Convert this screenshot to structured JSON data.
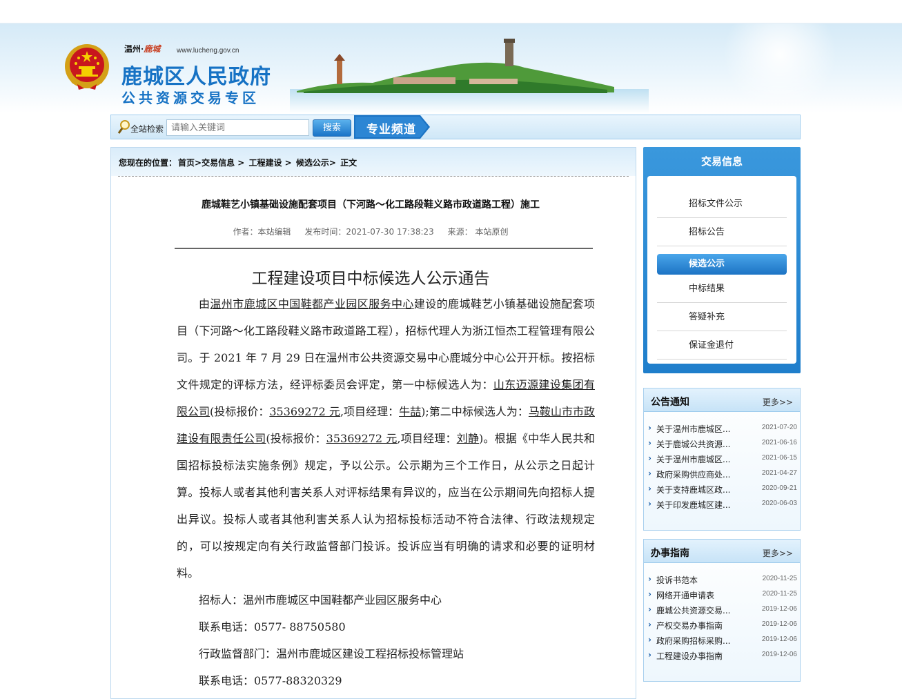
{
  "header": {
    "site_small": "温州·",
    "site_small_brush": "鹿城",
    "site_url": "www.lucheng.gov.cn",
    "site_title": "鹿城区人民政府",
    "site_subtitle": "公共资源交易专区"
  },
  "search": {
    "label": "全站检索",
    "placeholder": "请输入关键词",
    "button_label": "搜索",
    "channel_label": "专业频道"
  },
  "breadcrumb": {
    "prefix": "您现在的位置：",
    "items": [
      "首页>交易信息 >",
      "工程建设 >",
      "候选公示>",
      "正文"
    ]
  },
  "article": {
    "title": "鹿城鞋艺小镇基础设施配套项目（下河路～化工路段鞋义路市政道路工程）施工",
    "author": "作者：本站编辑",
    "publish_time": "发布时间：2021-07-30 17:38:23",
    "source": "来源： 本站原创",
    "notice_title": "工程建设项目中标候选人公示通告",
    "p1_a": "由",
    "p1_link": "温州市鹿城区中国鞋都产业园区服务中心",
    "p1_b": "建设的鹿城鞋艺小镇基础设施配套项目（下河路～化工路段鞋义路市政道路工程），招标代理人为浙江恒杰工程管理有限公司。于 2021 年 7 月 29 日在温州市公共资源交易中心鹿城分中心公开开标。按招标文件规定的评标方法，经评标委员会评定，第一中标候选人为：",
    "cand1": "山东迈源建设集团有限公司",
    "bid_label_1": "(投标报价：",
    "bid1": "35369272 元",
    "pm_label_1": ",项目经理：",
    "pm1": "牛喆",
    "second_label": ");第二中标候选人为：",
    "cand2": "马鞍山市市政建设有限责任公司",
    "bid_label_2": "(投标报价：",
    "bid2": "35369272 元",
    "pm_label_2": ",项目经理：",
    "pm2": "刘静",
    "p1_end": ")。根据《中华人民共和国招标投标法实施条例》规定，予以公示。公示期为三个工作日，从公示之日起计算。投标人或者其他利害关系人对评标结果有异议的，应当在公示期间先向招标人提出异议。投标人或者其他利害关系人认为招标投标活动不符合法律、行政法规规定的，可以按规定向有关行政监督部门投诉。投诉应当有明确的请求和必要的证明材料。",
    "tenderer": "招标人：温州市鹿城区中国鞋都产业园区服务中心",
    "phone1": "联系电话：0577- 88750580",
    "supervisor": "行政监督部门：温州市鹿城区建设工程招标投标管理站",
    "phone2": "联系电话：0577-88320329"
  },
  "sidebar": {
    "title": "交易信息",
    "items": [
      "招标文件公示",
      "招标公告",
      "候选公示",
      "中标结果",
      "答疑补充",
      "保证金退付"
    ],
    "active_index": 2
  },
  "notices": {
    "title": "公告通知",
    "more": "更多>>",
    "rows": [
      {
        "title": "关于温州市鹿城区...",
        "date": "2021-07-20"
      },
      {
        "title": "关于鹿城公共资源...",
        "date": "2021-06-16"
      },
      {
        "title": "关于温州市鹿城区...",
        "date": "2021-06-15"
      },
      {
        "title": "政府采购供应商处...",
        "date": "2021-04-27"
      },
      {
        "title": "关于支持鹿城区政...",
        "date": "2020-09-21"
      },
      {
        "title": "关于印发鹿城区建...",
        "date": "2020-06-03"
      }
    ]
  },
  "guides": {
    "title": "办事指南",
    "more": "更多>>",
    "rows": [
      {
        "title": "投诉书范本",
        "date": "2020-11-25"
      },
      {
        "title": "网络开通申请表",
        "date": "2020-11-25"
      },
      {
        "title": "鹿城公共资源交易...",
        "date": "2019-12-06"
      },
      {
        "title": "产权交易办事指南",
        "date": "2019-12-06"
      },
      {
        "title": "政府采购招标采购...",
        "date": "2019-12-06"
      },
      {
        "title": "工程建设办事指南",
        "date": "2019-12-06"
      }
    ]
  },
  "colors": {
    "brand_blue": "#1672c4",
    "active_menu": "#1c73c4"
  }
}
